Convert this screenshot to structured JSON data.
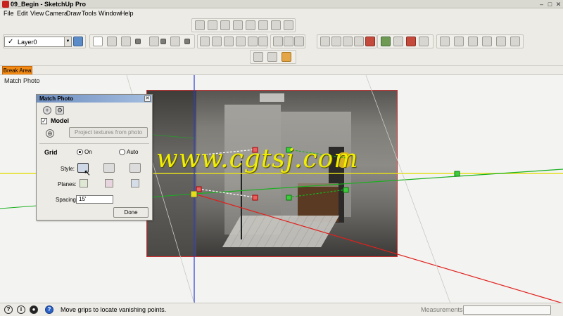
{
  "window": {
    "title": "09_Begin - SketchUp Pro"
  },
  "menu": [
    "File",
    "Edit",
    "View",
    "Camera",
    "Draw",
    "Tools",
    "Window",
    "Help"
  ],
  "layer": {
    "selected": "Layer0"
  },
  "scene_tab": "Break Area",
  "viewport": {
    "label": "Match Photo",
    "watermark": "www.cgtsj.com"
  },
  "match_photo": {
    "title": "Match Photo",
    "model_label": "Model",
    "model_checked": true,
    "project_button": "Project textures from photo",
    "grid_label": "Grid",
    "grid_on": "On",
    "grid_auto": "Auto",
    "style_label": "Style:",
    "planes_label": "Planes:",
    "spacing_label": "Spacing:",
    "spacing_value": "15'",
    "done_button": "Done"
  },
  "status": {
    "message": "Move grips to locate vanishing points.",
    "measurements_label": "Measurements",
    "measurements_value": ""
  },
  "colors": {
    "break_tab": "#f28a14",
    "x_axis": "#e0201c",
    "y_axis": "#19b01e",
    "z_axis": "#2a3dd6",
    "horizon": "#e5df1a",
    "watermark": "#f2ee00"
  }
}
